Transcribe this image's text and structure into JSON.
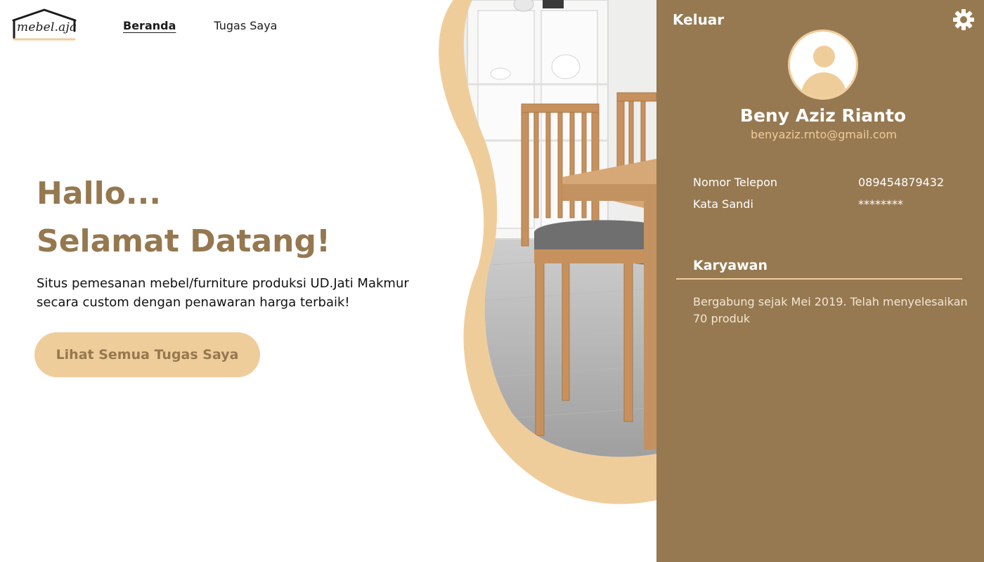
{
  "app": {
    "logo_text": "mebel.aja"
  },
  "nav": {
    "items": [
      {
        "label": "Beranda",
        "active": true
      },
      {
        "label": "Tugas Saya",
        "active": false
      }
    ]
  },
  "hero": {
    "title_line1": "Hallo...",
    "title_line2": "Selamat Datang!",
    "description": "Situs  pemesanan mebel/furniture produksi UD.Jati Makmur secara custom dengan penawaran harga terbaik!",
    "cta_label": "Lihat Semua Tugas Saya"
  },
  "profile": {
    "logout_label": "Keluar",
    "settings_icon": "gear-icon",
    "avatar_icon": "user-avatar-icon",
    "name": "Beny Aziz Rianto",
    "email": "benyaziz.rnto@gmail.com",
    "phone_label": "Nomor Telepon",
    "phone_value": "089454879432",
    "password_label": "Kata Sandi",
    "password_value": "********",
    "role": "Karyawan",
    "bio": "Bergabung sejak Mei 2019. Telah menyelesaikan 70 produk"
  },
  "colors": {
    "accent_brown": "#967951",
    "accent_tan": "#efcd9b",
    "title_brown": "#95784f"
  }
}
